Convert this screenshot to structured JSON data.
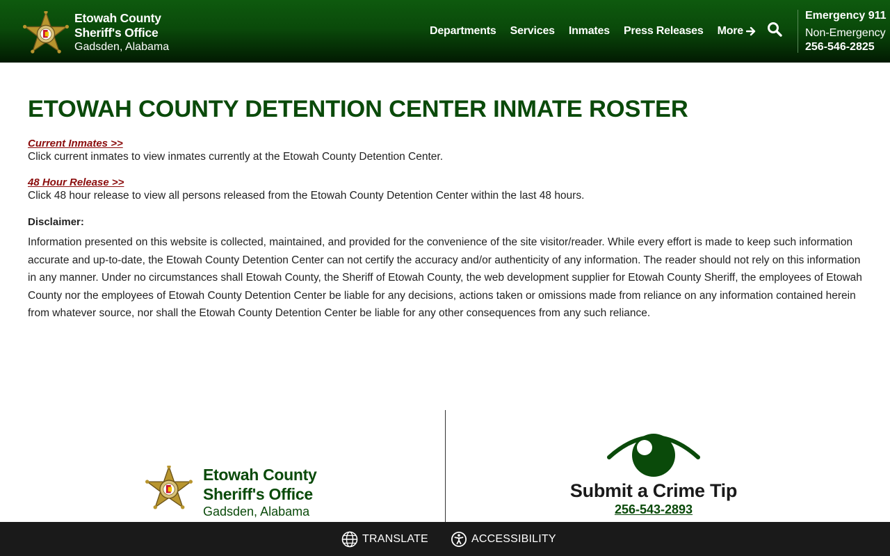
{
  "header": {
    "title_line1": "Etowah County",
    "title_line2": "Sheriff's Office",
    "location": "Gadsden, Alabama",
    "nav": [
      "Departments",
      "Services",
      "Inmates",
      "Press Releases"
    ],
    "more_label": "More",
    "emergency": "Emergency 911",
    "non_emergency_label": "Non-Emergency",
    "non_emergency_number": "256-546-2825"
  },
  "main": {
    "title": "ETOWAH COUNTY DETENTION CENTER INMATE ROSTER",
    "current_link": "Current Inmates >>",
    "current_desc": "Click current inmates to view inmates currently at the Etowah County Detention Center.",
    "release_link": "48 Hour Release >>",
    "release_desc": "Click 48 hour release to view all persons released from the Etowah County Detention Center within the last 48 hours.",
    "disclaimer_label": "Disclaimer:",
    "disclaimer_text": "Information presented on this website is collected, maintained, and provided for the convenience of the site visitor/reader. While every effort is made to keep such information accurate and up-to-date, the Etowah County Detention Center can not certify the accuracy and/or authenticity of any information. The reader should not rely on this information in any manner.  Under no circumstances shall Etowah County, the Sheriff of Etowah County, the web development supplier for Etowah County Sheriff, the employees of Etowah County nor the employees of Etowah County Detention Center be liable for any decisions, actions taken or omissions made from reliance on any information contained herein from whatever source, nor shall the Etowah County Detention Center be liable for any other consequences from any such reliance."
  },
  "footer": {
    "brand_line1": "Etowah County",
    "brand_line2": "Sheriff's Office",
    "brand_location": "Gadsden, Alabama",
    "tip_title": "Submit a Crime Tip",
    "tip_phone": "256-543-2893"
  },
  "bottom_bar": {
    "translate": "TRANSLATE",
    "accessibility": "ACCESSIBILITY"
  },
  "colors": {
    "brand_green": "#0a4a0a",
    "link_red": "#8b0d0d",
    "bar_dark": "#1a1a1a"
  },
  "icons": [
    "sheriff-badge-icon",
    "arrow-right-icon",
    "search-icon",
    "eye-icon",
    "globe-icon",
    "accessibility-icon"
  ]
}
